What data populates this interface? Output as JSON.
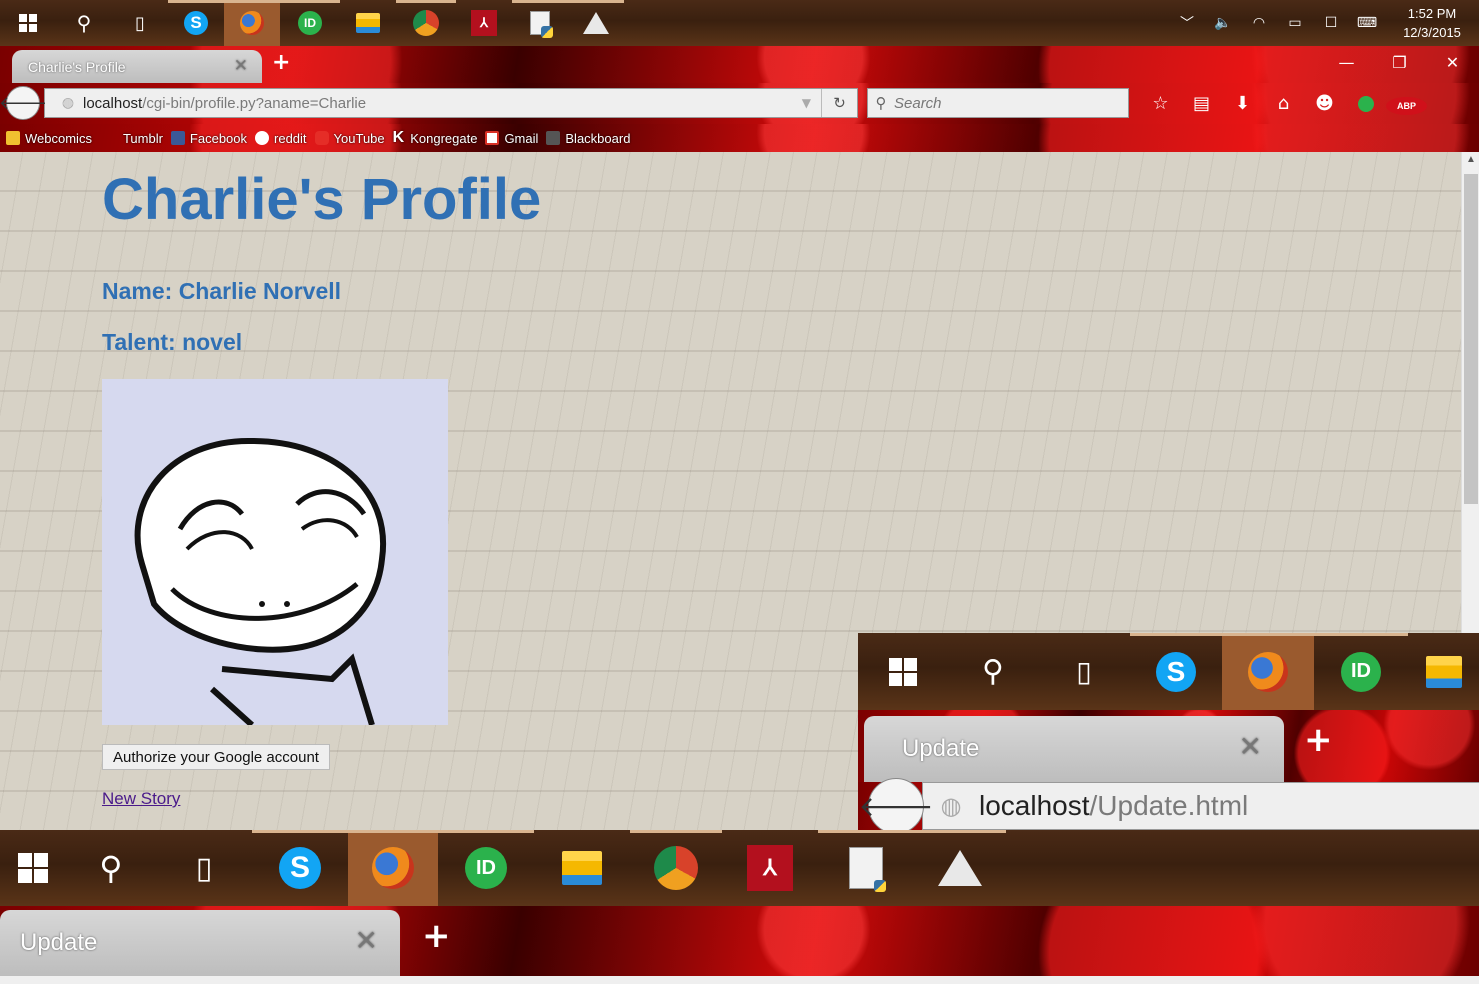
{
  "taskbar": {
    "apps": [
      "windows-start",
      "search",
      "task-view",
      "skype",
      "firefox",
      "idbooth",
      "file-explorer",
      "swirl-app",
      "acrobat",
      "python-doc",
      "inkscape"
    ],
    "time": "1:52 PM",
    "date": "12/3/2015"
  },
  "browser": {
    "tab_title": "Charlie's Profile",
    "new_tab": "+",
    "url_host": "localhost",
    "url_path": "/cgi-bin/profile.py?aname=Charlie",
    "search_placeholder": "Search",
    "abp_label": "ABP",
    "bookmarks": [
      "Webcomics",
      "Tumblr",
      "Facebook",
      "reddit",
      "YouTube",
      "Kongregate",
      "Gmail",
      "Blackboard"
    ]
  },
  "page": {
    "title": "Charlie's Profile",
    "name_line": "Name: Charlie Norvell",
    "talent_line": "Talent: novel",
    "auth_button": "Authorize your Google account",
    "new_story_link": "New Story"
  },
  "overlay_window": {
    "tab_title": "Update",
    "url_host": "localhost",
    "url_path": "/Update.html"
  },
  "bottom_window": {
    "tab_title": "Update"
  },
  "colors": {
    "heading": "#3070b4",
    "theme_red": "#c40606",
    "taskbar_brown": "#3a200f"
  }
}
